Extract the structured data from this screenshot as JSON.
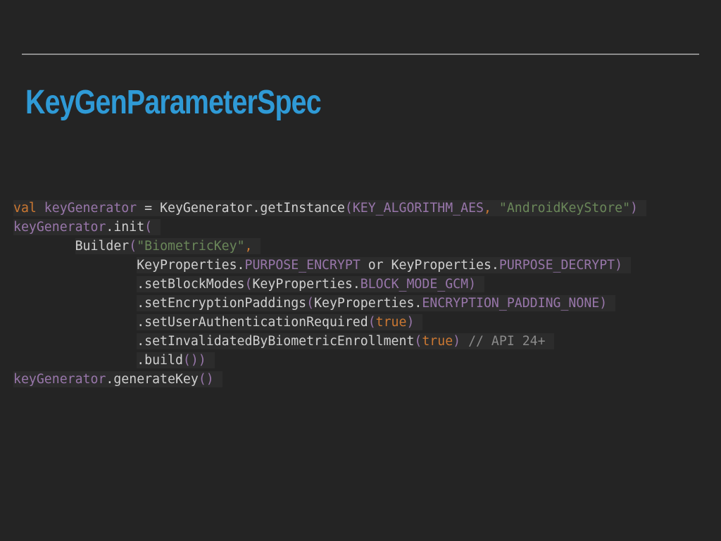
{
  "slide": {
    "title": "KeyGenParameterSpec"
  },
  "code": {
    "lines": [
      [
        {
          "t": "val",
          "c": "kw"
        },
        {
          "t": " keyGenerator",
          "c": "id"
        },
        {
          "t": " = KeyGenerator.getInstance",
          "c": "txt"
        },
        {
          "t": "(",
          "c": "par"
        },
        {
          "t": "KEY_ALGORITHM_AES",
          "c": "const"
        },
        {
          "t": ", ",
          "c": "kw"
        },
        {
          "t": "\"AndroidKeyStore\"",
          "c": "str"
        },
        {
          "t": ")",
          "c": "par"
        }
      ],
      [
        {
          "t": "keyGenerator",
          "c": "id"
        },
        {
          "t": ".init",
          "c": "txt"
        },
        {
          "t": "(",
          "c": "par"
        }
      ],
      [
        {
          "t": "        Builder",
          "c": "txt"
        },
        {
          "t": "(",
          "c": "par"
        },
        {
          "t": "\"BiometricKey\"",
          "c": "str"
        },
        {
          "t": ",",
          "c": "kw"
        }
      ],
      [
        {
          "t": "                KeyProperties.",
          "c": "txt"
        },
        {
          "t": "PURPOSE_ENCRYPT",
          "c": "const"
        },
        {
          "t": " or KeyProperties.",
          "c": "txt"
        },
        {
          "t": "PURPOSE_DECRYPT",
          "c": "const"
        },
        {
          "t": ")",
          "c": "par"
        }
      ],
      [
        {
          "t": "                .setBlockModes",
          "c": "txt"
        },
        {
          "t": "(",
          "c": "par"
        },
        {
          "t": "KeyProperties.",
          "c": "txt"
        },
        {
          "t": "BLOCK_MODE_GCM",
          "c": "const"
        },
        {
          "t": ")",
          "c": "par"
        }
      ],
      [
        {
          "t": "                .setEncryptionPaddings",
          "c": "txt"
        },
        {
          "t": "(",
          "c": "par"
        },
        {
          "t": "KeyProperties.",
          "c": "txt"
        },
        {
          "t": "ENCRYPTION_PADDING_NONE",
          "c": "const"
        },
        {
          "t": ")",
          "c": "par"
        }
      ],
      [
        {
          "t": "                .setUserAuthenticationRequired",
          "c": "txt"
        },
        {
          "t": "(",
          "c": "par"
        },
        {
          "t": "true",
          "c": "bool"
        },
        {
          "t": ")",
          "c": "par"
        }
      ],
      [
        {
          "t": "                .setInvalidatedByBiometricEnrollment",
          "c": "txt"
        },
        {
          "t": "(",
          "c": "par"
        },
        {
          "t": "true",
          "c": "bool"
        },
        {
          "t": ")",
          "c": "par"
        },
        {
          "t": " // API 24+",
          "c": "cmt"
        }
      ],
      [
        {
          "t": "                .build",
          "c": "txt"
        },
        {
          "t": "())",
          "c": "par"
        }
      ],
      [
        {
          "t": "keyGenerator",
          "c": "id"
        },
        {
          "t": ".generateKey",
          "c": "txt"
        },
        {
          "t": "()",
          "c": "par"
        }
      ]
    ]
  }
}
